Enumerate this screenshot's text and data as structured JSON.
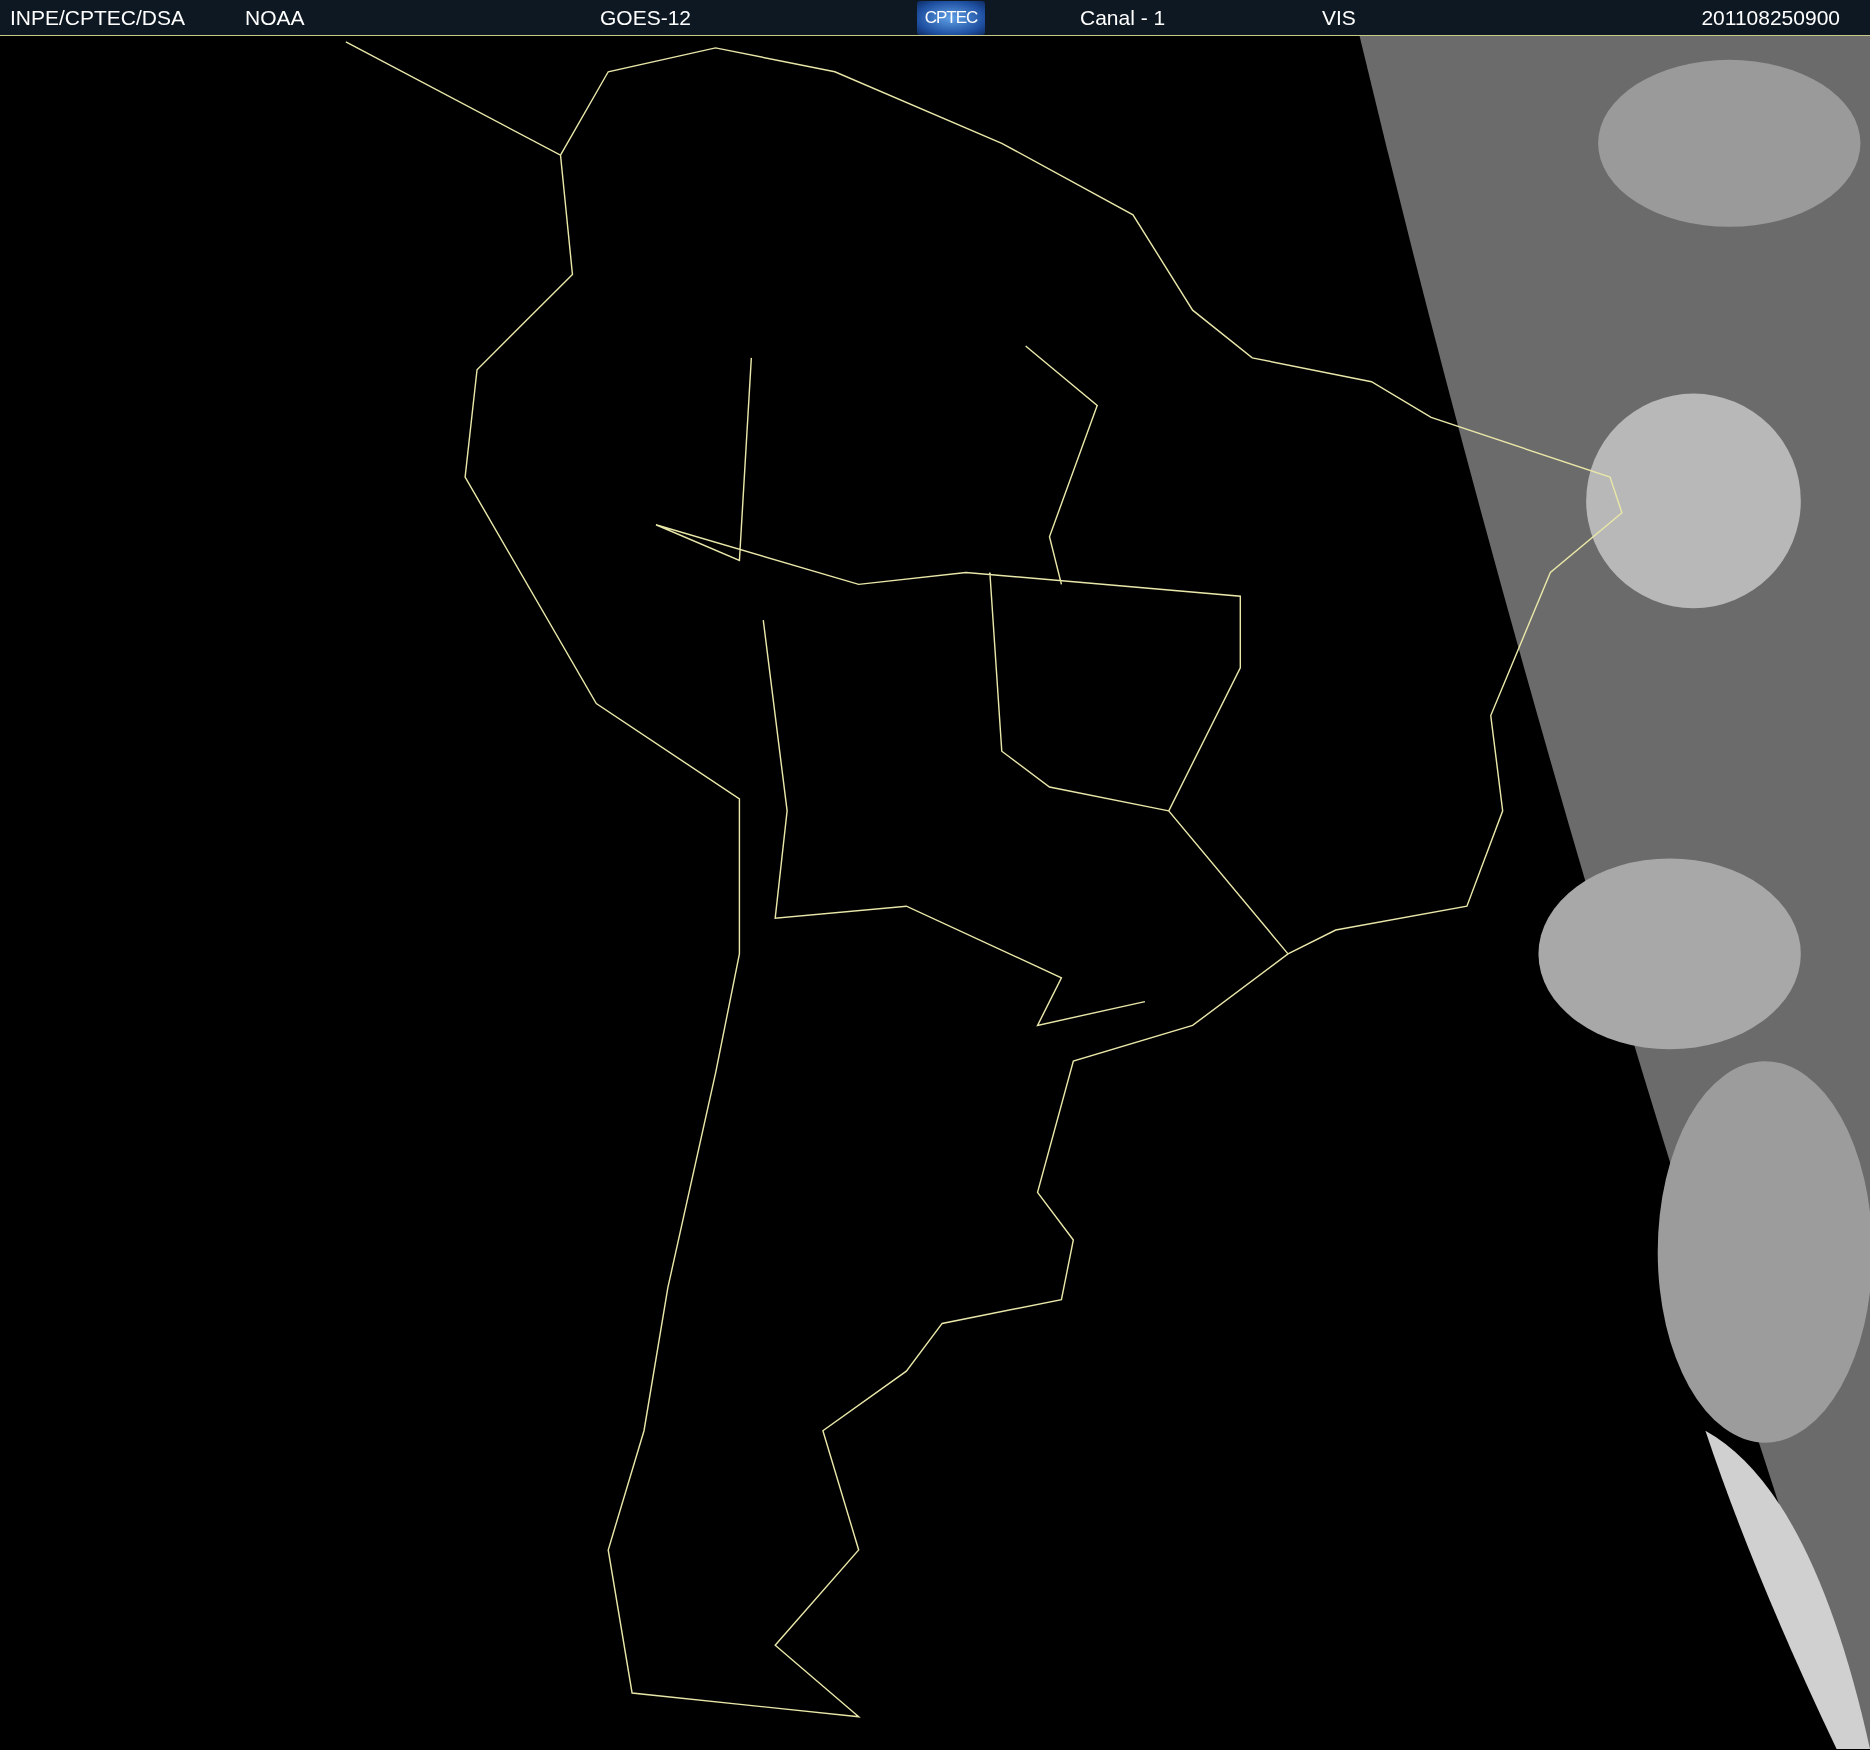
{
  "header": {
    "source": "INPE/CPTEC/DSA",
    "agency": "NOAA",
    "satellite": "GOES-12",
    "logo": "CPTEC",
    "channel": "Canal - 1",
    "band": "VIS",
    "timestamp": "201108250900"
  }
}
